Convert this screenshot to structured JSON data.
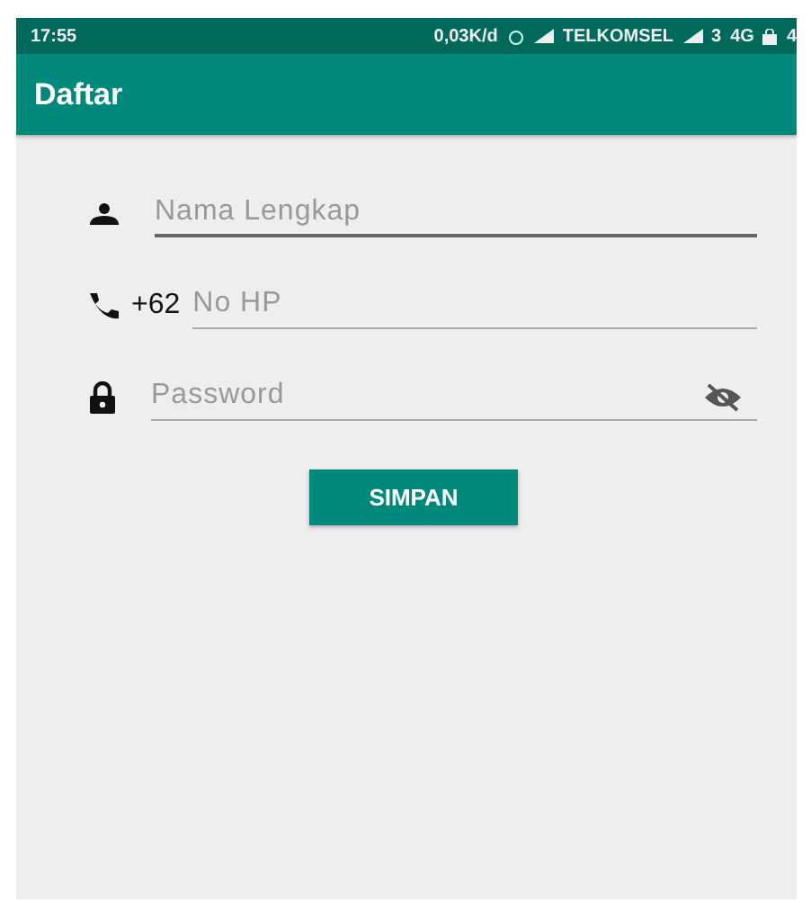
{
  "status_bar": {
    "time": "17:55",
    "speed": "0,03K/d",
    "carrier": "TELKOMSEL",
    "sim": "3",
    "network": "4G",
    "battery": "4"
  },
  "app_bar": {
    "title": "Daftar"
  },
  "fields": [
    {
      "kind": "name",
      "placeholder": "Nama Lengkap",
      "focused": true
    },
    {
      "kind": "phone",
      "prefix": "+62",
      "placeholder": "No HP",
      "focused": false
    },
    {
      "kind": "password",
      "placeholder": "Password",
      "focused": false
    }
  ],
  "button": {
    "label": "SIMPAN"
  }
}
